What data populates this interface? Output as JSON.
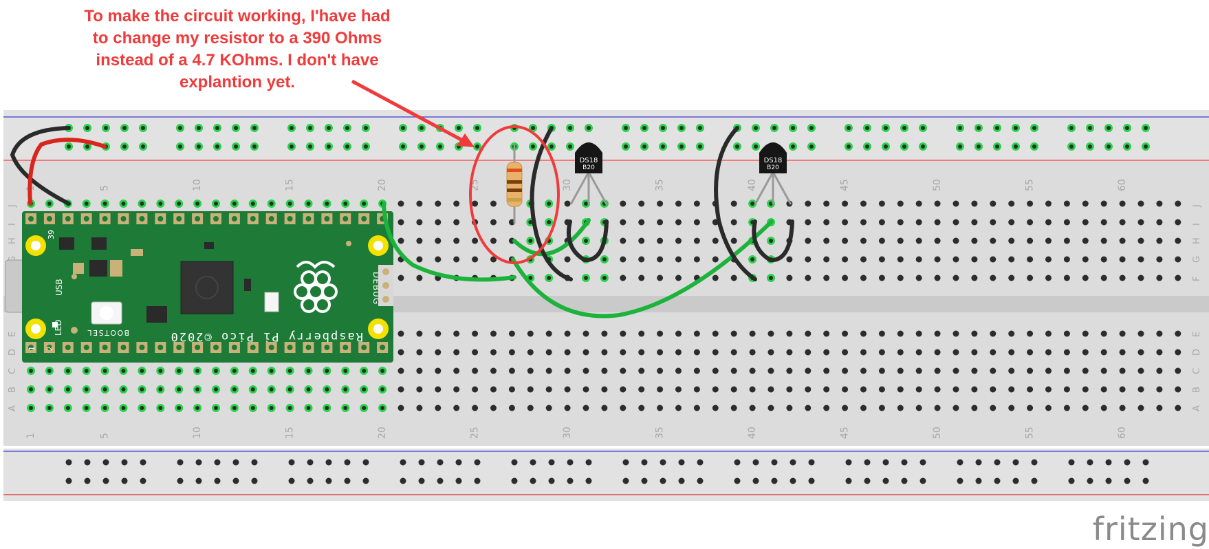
{
  "annotation": {
    "text": "To make the circuit working, I'have had to change my resistor to a 390 Ohms instead of a 4.7 KOhms. I don't have explantion yet."
  },
  "breadboard": {
    "column_numbers": [
      "1",
      "5",
      "10",
      "15",
      "20",
      "25",
      "30",
      "35",
      "40",
      "45",
      "50",
      "55",
      "60"
    ],
    "row_letters_top": [
      "J",
      "I",
      "H",
      "G",
      "F"
    ],
    "row_letters_bottom": [
      "E",
      "D",
      "C",
      "B",
      "A"
    ]
  },
  "pico": {
    "usb_label": "USB",
    "bootsel_label": "BOOTSEL",
    "led_label": "LED",
    "debug_label": "DEBUG",
    "brand_label": "Raspberry Pi Pico ©2020",
    "pin_top": "39",
    "pin_bottom": "2",
    "pin_bottom_2": "1"
  },
  "sensors": [
    {
      "label_line1": "DS18",
      "label_line2": "B20"
    },
    {
      "label_line1": "DS18",
      "label_line2": "B20"
    }
  ],
  "logo": {
    "text": "fritzing"
  },
  "colors": {
    "annotation": "#ef3b3b",
    "board": "#dcdcdc",
    "pico": "#1e7a37",
    "wire_green": "#1bb33b",
    "wire_red": "#d9261c",
    "wire_black": "#2a2a2a",
    "rail_blue": "#3b3bd6",
    "rail_red": "#e03030"
  }
}
